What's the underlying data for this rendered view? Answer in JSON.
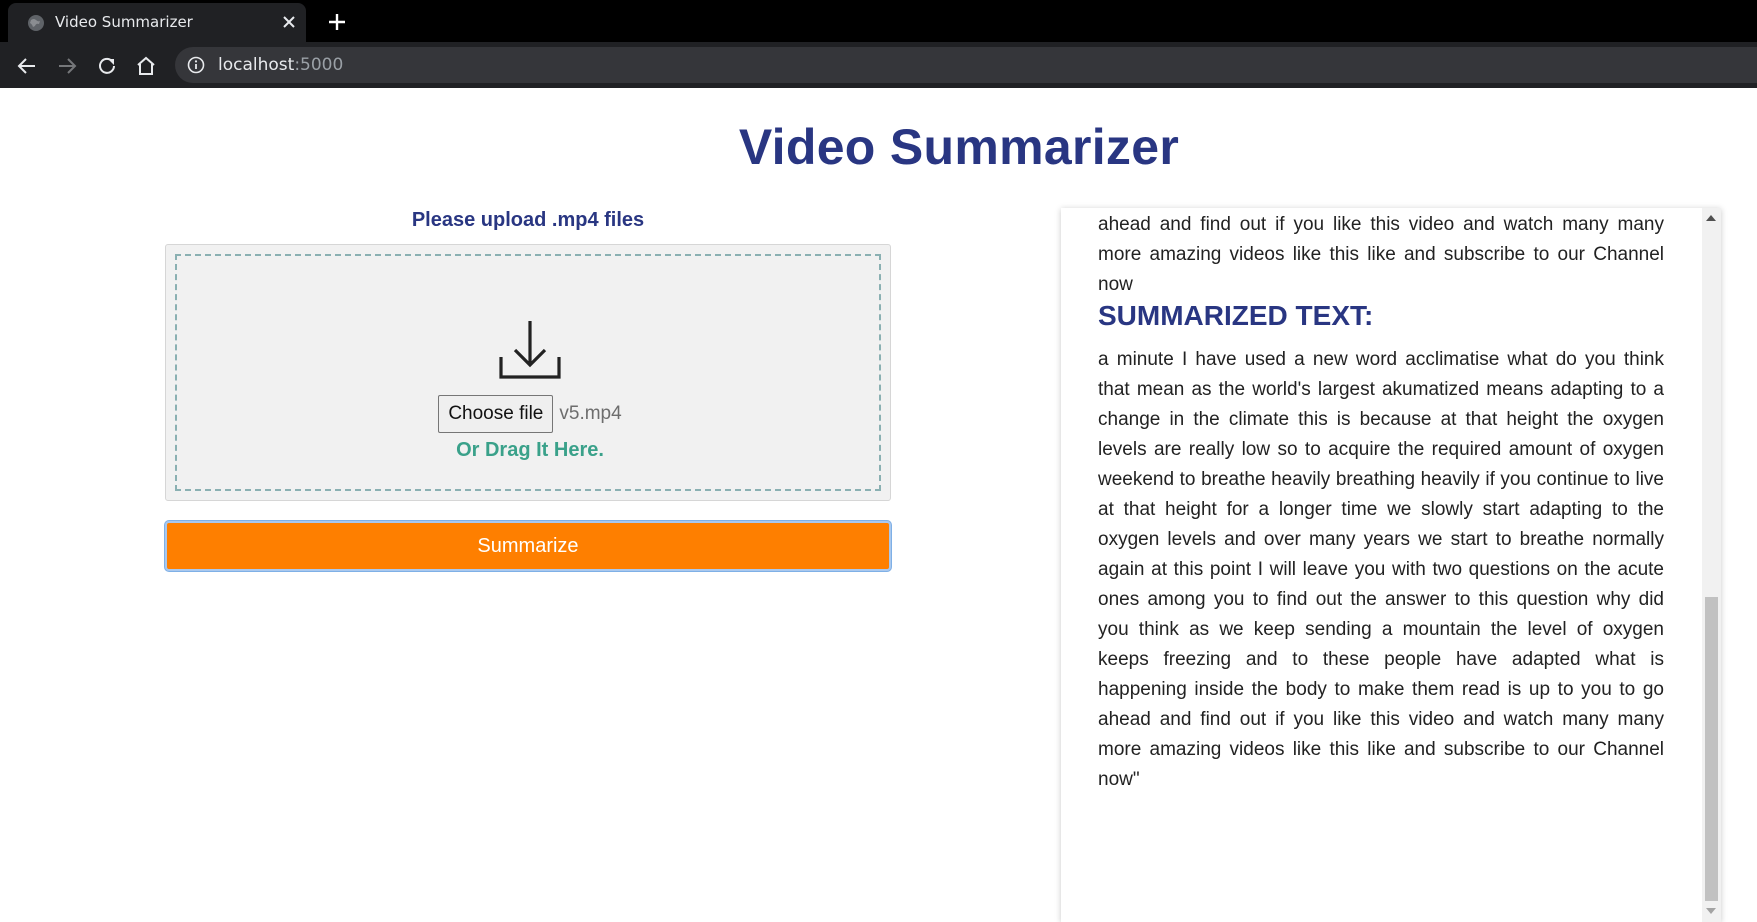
{
  "browser": {
    "tab_title": "Video Summarizer",
    "url_host": "localhost",
    "url_port": ":5000"
  },
  "page": {
    "title": "Video Summarizer",
    "upload_label": "Please upload .mp4 files",
    "choose_file_label": "Choose file",
    "selected_file": "v5.mp4",
    "drag_text": "Or Drag It Here.",
    "summarize_label": "Summarize"
  },
  "result": {
    "transcript_tail": "ahead and find out if you like this video and watch many many more amazing videos like this like and subscribe to our Channel now",
    "summary_heading": "SUMMARIZED TEXT:",
    "summary_text": "a minute I have used a new word acclimatise what do you think that mean as the world's largest akumatized means adapting to a change in the climate this is because at that height the oxygen levels are really low so to acquire the required amount of oxygen weekend to breathe heavily breathing heavily if you continue to live at that height for a longer time we slowly start adapting to the oxygen levels and over many years we start to breathe normally again at this point I will leave you with two questions on the acute ones among you to find out the answer to this question why did you think as we keep sending a mountain the level of oxygen keeps freezing and to these people have adapted what is happening inside the body to make them read is up to you to go ahead and find out if you like this video and watch many many more amazing videos like this like and subscribe to our Channel now\""
  },
  "colors": {
    "title_blue": "#293682",
    "accent_orange": "#fe7f00",
    "drag_green": "#3aa18a"
  },
  "icons": [
    "globe-icon",
    "close-icon",
    "plus-icon",
    "arrow-left-icon",
    "arrow-right-icon",
    "reload-icon",
    "home-icon",
    "info-icon",
    "download-icon"
  ]
}
